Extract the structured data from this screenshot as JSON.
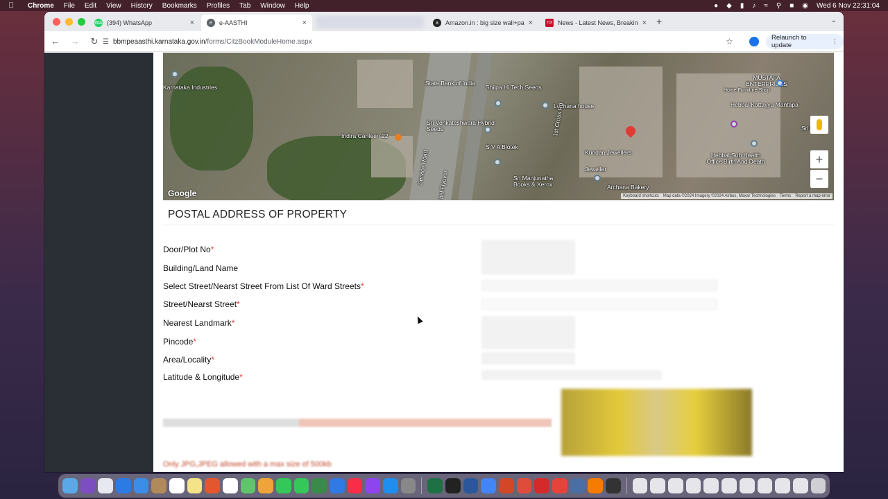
{
  "menubar": {
    "app": "Chrome",
    "items": [
      "File",
      "Edit",
      "View",
      "History",
      "Bookmarks",
      "Profiles",
      "Tab",
      "Window",
      "Help"
    ],
    "datetime": "Wed 6 Nov  22:31:04"
  },
  "tabs": [
    {
      "title": "(394) WhatsApp",
      "color": "#25d366",
      "fav": "WA"
    },
    {
      "title": "e-AASTHI",
      "color": "#5f6368",
      "fav": "e"
    },
    {
      "title": "Amazon.in : big size wall+pai",
      "color": "#222222",
      "fav": "a"
    },
    {
      "title": "News - Latest News, Breaking",
      "color": "#c8102e",
      "fav": "TOI"
    }
  ],
  "toolbar": {
    "url_site": "bbmpeaasthi.karnataka.gov.in",
    "url_path": "/forms/CitzBookModuleHome.aspx",
    "relaunch": "Relaunch to update"
  },
  "map": {
    "labels": [
      {
        "text": "Karnataka Industries"
      },
      {
        "text": "State Bank of India"
      },
      {
        "text": "Shilpa Hi Tech Seeds"
      },
      {
        "text": "Lochana house"
      },
      {
        "text": "MUSTAFA ENTERPRISES"
      },
      {
        "text": "Home Furniture Shop"
      },
      {
        "text": "Hebbal Kattayya Mantapa"
      },
      {
        "text": "Sri Ba"
      },
      {
        "text": "Sri Venkateshwara Hybrid Seeds"
      },
      {
        "text": "Indira Canteen 22"
      },
      {
        "text": "S V A Biotek"
      },
      {
        "text": "1st Cross Rd"
      },
      {
        "text": "Service Road"
      },
      {
        "text": "bal Flyover"
      },
      {
        "text": "Kundan Jewellers"
      },
      {
        "text": "Jeweller"
      },
      {
        "text": "Hebbal Sub Health Office Birth And Death"
      },
      {
        "text": "Sri Manjunatha Books & Xerox"
      },
      {
        "text": "Archana Bakery"
      }
    ],
    "google": "Google",
    "footer": [
      "Keyboard shortcuts",
      "Map data ©2024 Imagery ©2024 Airbus, Maxar Technologies",
      "Terms",
      "Report a map error"
    ]
  },
  "form": {
    "title": "POSTAL ADDRESS OF PROPERTY",
    "fields": [
      {
        "label": "Door/Plot No",
        "required": "*"
      },
      {
        "label": "Building/Land Name",
        "required": ""
      },
      {
        "label": "Select Street/Nearst Street From List Of Ward Streets",
        "required": "*"
      },
      {
        "label": "Street/Nearst Street",
        "required": "*"
      },
      {
        "label": "Nearest Landmark",
        "required": "*"
      },
      {
        "label": "Pincode",
        "required": "*"
      },
      {
        "label": "Area/Locality",
        "required": "*"
      },
      {
        "label": "Latitude & Longitude",
        "required": "*"
      }
    ],
    "upload_note": "Only JPG,JPEG allowed with a max size of 500kb"
  }
}
